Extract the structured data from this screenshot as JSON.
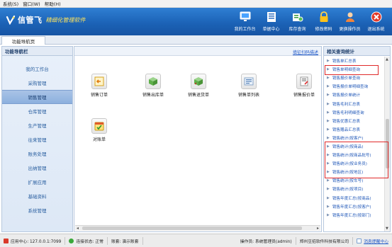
{
  "menubar": {
    "items": [
      "系统(S)",
      "窗口(W)",
      "帮助(H)"
    ]
  },
  "banner": {
    "app_name": "信管飞",
    "tagline": "精细化管理软件",
    "tools": [
      {
        "label": "我的工作台",
        "icon": "monitor-icon"
      },
      {
        "label": "单据中心",
        "icon": "document-center-icon"
      },
      {
        "label": "库存查询",
        "icon": "stock-query-icon"
      },
      {
        "label": "修改密码",
        "icon": "lock-icon"
      },
      {
        "label": "更换操作员",
        "icon": "user-icon"
      },
      {
        "label": "退出系统",
        "icon": "exit-icon"
      }
    ]
  },
  "tabs": [
    {
      "label": "功能导航页"
    }
  ],
  "nav": {
    "header": "功能导航栏",
    "items": [
      "我的工作台",
      "采购管理",
      "销售管理",
      "仓库管理",
      "生产管理",
      "往来管理",
      "账务处理",
      "出纳管理",
      "扩展应用",
      "基础资料",
      "系统管理"
    ],
    "active_index": 2
  },
  "main": {
    "link": "填征扫码描述",
    "functions": [
      {
        "label": "销售订单",
        "icon": "sales-order-icon"
      },
      {
        "label": "销售出库单",
        "icon": "sales-outbound-icon"
      },
      {
        "label": "销售退货单",
        "icon": "sales-return-icon"
      },
      {
        "label": "销售单列表",
        "icon": "sales-list-icon"
      },
      {
        "label": "销售报价单",
        "icon": "sales-quote-icon"
      },
      {
        "label": "对账单",
        "icon": "statement-icon"
      }
    ]
  },
  "right": {
    "header": "相关查询统计",
    "items": [
      "销售单汇总表",
      "销售单明细查询",
      "销售报价单查询",
      "销售报价单明细查询",
      "销售报价单统计",
      "销售毛利汇总表",
      "销售毛利明细查询",
      "销售优惠汇总表",
      "销售赠品汇总表",
      "销售统计(按客户)",
      "销售统计(按商品)",
      "销售统计(按商品批号)",
      "销售统计(按业务员)",
      "销售统计(按地区)",
      "销售统计(按车号)",
      "销售统计(按项目)",
      "销售年度汇总(按商品)",
      "销售年度汇总(按客户)",
      "销售年度汇总(按部门)"
    ]
  },
  "status": {
    "center": "应用中心: 127.0.0.1:7099",
    "connection": "连接状态: 正常",
    "account": "账套: 演示账套",
    "operator": "操作员: 系统管理员(admin)",
    "company": "郑州豆招软件科技有限公司",
    "message": "消息提醒中心"
  },
  "colors": {
    "banner": "#1c63b7",
    "highlight_box": "#e02a2a",
    "link": "#2158b8"
  }
}
